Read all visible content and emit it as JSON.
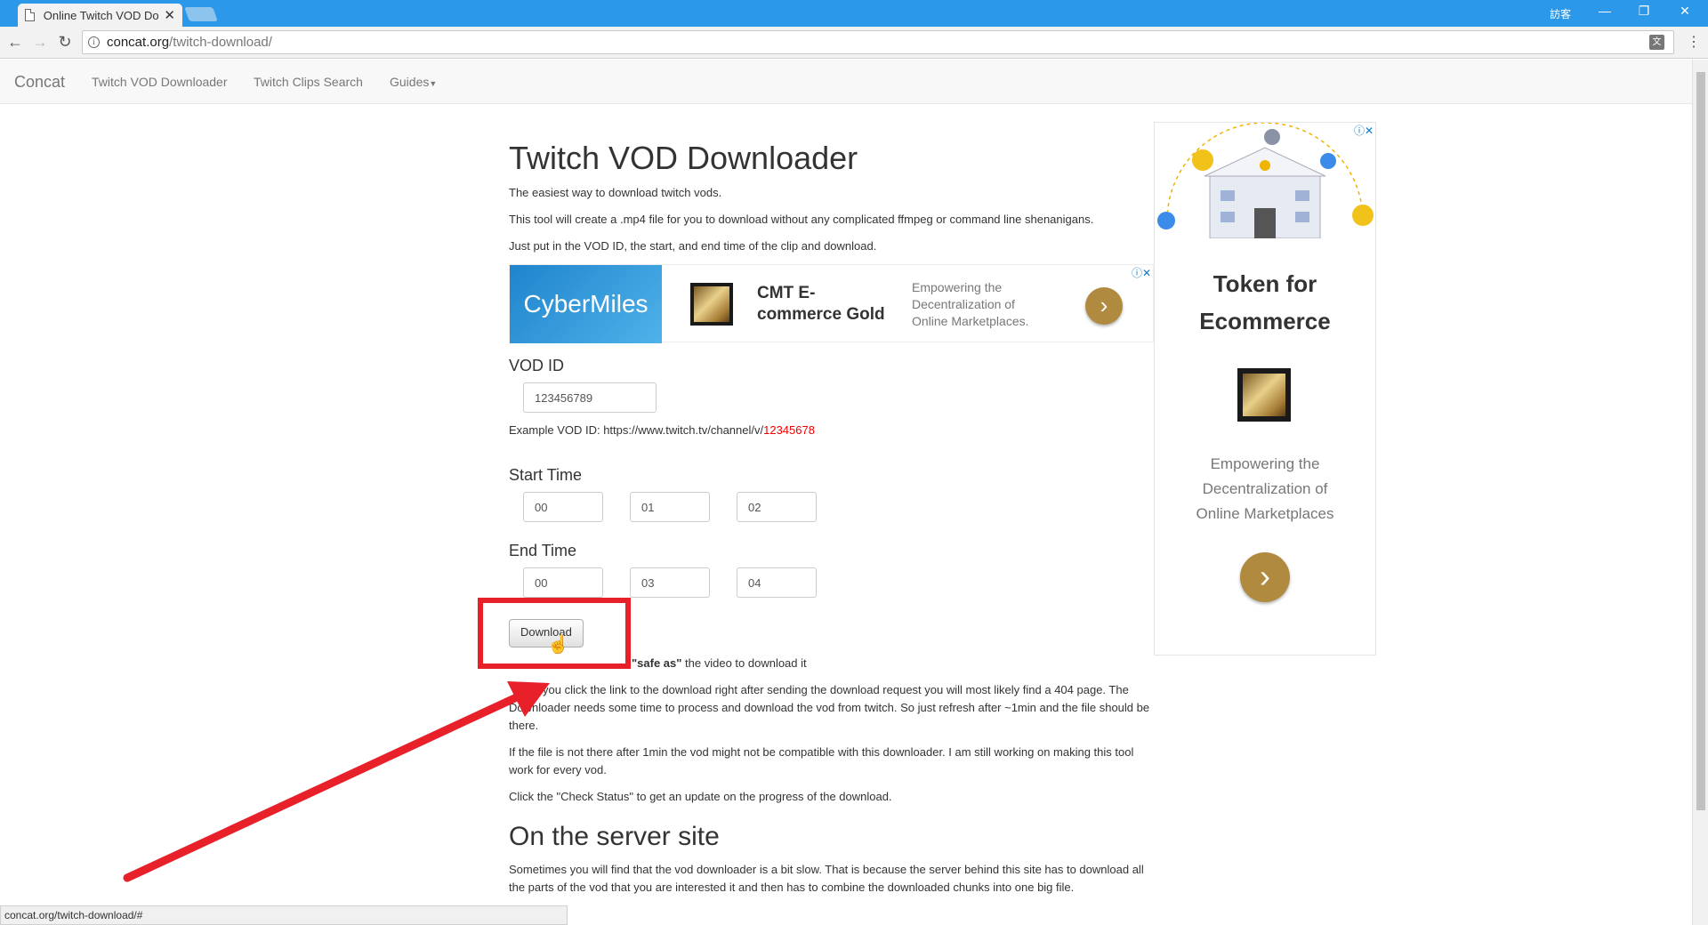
{
  "browser": {
    "tab_title": "Online Twitch VOD Do",
    "user_label": "訪客",
    "url_host": "concat.org",
    "url_path": "/twitch-download/",
    "status_url": "concat.org/twitch-download/#"
  },
  "nav": {
    "brand": "Concat",
    "links": [
      "Twitch VOD Downloader",
      "Twitch Clips Search",
      "Guides"
    ]
  },
  "page": {
    "title": "Twitch VOD Downloader",
    "intro": [
      "The easiest way to download twitch vods.",
      "This tool will create a .mp4 file for you to download without any complicated ffmpeg or command line shenanigans.",
      "Just put in the VOD ID, the start, and end time of the clip and download."
    ],
    "vod_label": "VOD ID",
    "vod_value": "123456789",
    "example_prefix": "Example VOD ID: https://www.twitch.tv/channel/v/",
    "example_id": "12345678",
    "start_label": "Start Time",
    "start": [
      "00",
      "01",
      "02"
    ],
    "end_label": "End Time",
    "end": [
      "00",
      "03",
      "04"
    ],
    "download_label": "Download",
    "safe_as_bold": "\"safe as\"",
    "safe_as_rest": " the video to download it",
    "para_404": "you click the link to the download right after sending the download request you will most likely find a 404 page. The Downloader needs some time to process and download the vod from twitch. So just refresh after ~1min and the file should be there.",
    "para_compat": "If the file is not there after 1min the vod might not be compatible with this downloader. I am still working on making this tool work for every vod.",
    "para_status": "Click the \"Check Status\" to get an update on the progress of the download.",
    "server_heading": "On the server site",
    "server_para": "Sometimes you will find that the vod downloader is a bit slow. That is because the server behind this site has to download all the parts of the vod that you are interested it and then has to combine the downloaded chunks into one big file."
  },
  "banner_ad": {
    "logo": "CyberMiles",
    "title": "CMT E-commerce Gold",
    "subtitle": "Empowering the Decentralization of Online Marketplaces."
  },
  "side_ad": {
    "title": "Token for Ecommerce",
    "subtitle": "Empowering the Decentralization of Online Marketplaces"
  },
  "colors": {
    "chrome_blue": "#2b98e9",
    "annotation_red": "#e8202a",
    "ad_gold": "#b08a3e"
  }
}
